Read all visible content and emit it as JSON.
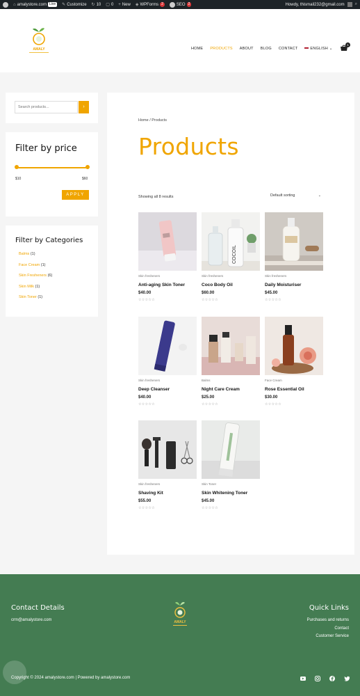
{
  "admin_bar": {
    "site": "amalystore.com",
    "live": "Live",
    "customize": "Customize",
    "updates": "10",
    "comments": "0",
    "new": "New",
    "wpforms": "WPForms",
    "wpforms_count": "2",
    "seo": "SEO",
    "seo_count": "2",
    "howdy": "Howdy, thismail232@gmail.com"
  },
  "nav": {
    "items": [
      "HOME",
      "PRODUCTS",
      "ABOUT",
      "BLOG",
      "CONTACT"
    ],
    "active": "PRODUCTS",
    "language": "ENGLISH",
    "cart_count": "1"
  },
  "sidebar": {
    "search_placeholder": "Search products...",
    "price_title": "Filter by price",
    "price_min": "$10",
    "price_max": "$60",
    "apply_label": "APPLY",
    "categories_title": "Filter by Categories",
    "categories": [
      {
        "name": "Balms",
        "count": "(1)"
      },
      {
        "name": "Face Cream",
        "count": "(1)"
      },
      {
        "name": "Skin Fresheners",
        "count": "(6)"
      },
      {
        "name": "Skin Milk",
        "count": "(1)"
      },
      {
        "name": "Skin Toner",
        "count": "(1)"
      }
    ]
  },
  "main": {
    "breadcrumb": "Home / Products",
    "title": "Products",
    "result_count": "Showing all 8 results",
    "sorting": "Default sorting"
  },
  "products": [
    {
      "category": "Skin fresheners",
      "name": "Anti-aging Skin Toner",
      "price": "$40.00",
      "rating": 0
    },
    {
      "category": "Skin fresheners",
      "name": "Coco Body Oil",
      "price": "$60.00",
      "rating": 0
    },
    {
      "category": "Skin fresheners",
      "name": "Daily Moisturiser",
      "price": "$45.00",
      "rating": 0
    },
    {
      "category": "Skin fresheners",
      "name": "Deep Cleanser",
      "price": "$40.00",
      "rating": 0
    },
    {
      "category": "Balms",
      "name": "Night Care Cream",
      "price": "$25.00",
      "rating": 0
    },
    {
      "category": "Face Cream",
      "name": "Rose Essential Oil",
      "price": "$30.00",
      "rating": 0
    },
    {
      "category": "Skin fresheners",
      "name": "Shaving Kit",
      "price": "$55.00",
      "rating": 0
    },
    {
      "category": "Skin Toner",
      "name": "Skin Whitening Toner",
      "price": "$45.00",
      "rating": 0
    }
  ],
  "footer": {
    "contact_title": "Contact Details",
    "email": "crm@amalystore.com",
    "quick_links_title": "Quick Links",
    "links": [
      "Purchases and returns",
      "Contact",
      "Customer Service"
    ],
    "copyright": "Copyright © 2024 amalystore.com | Powered by amalystore.com",
    "social_icons": [
      "youtube-icon",
      "instagram-icon",
      "facebook-icon",
      "twitter-icon"
    ]
  },
  "colors": {
    "accent": "#f0a500",
    "footer_bg": "#447c52",
    "admin_bar": "#1d2327"
  }
}
